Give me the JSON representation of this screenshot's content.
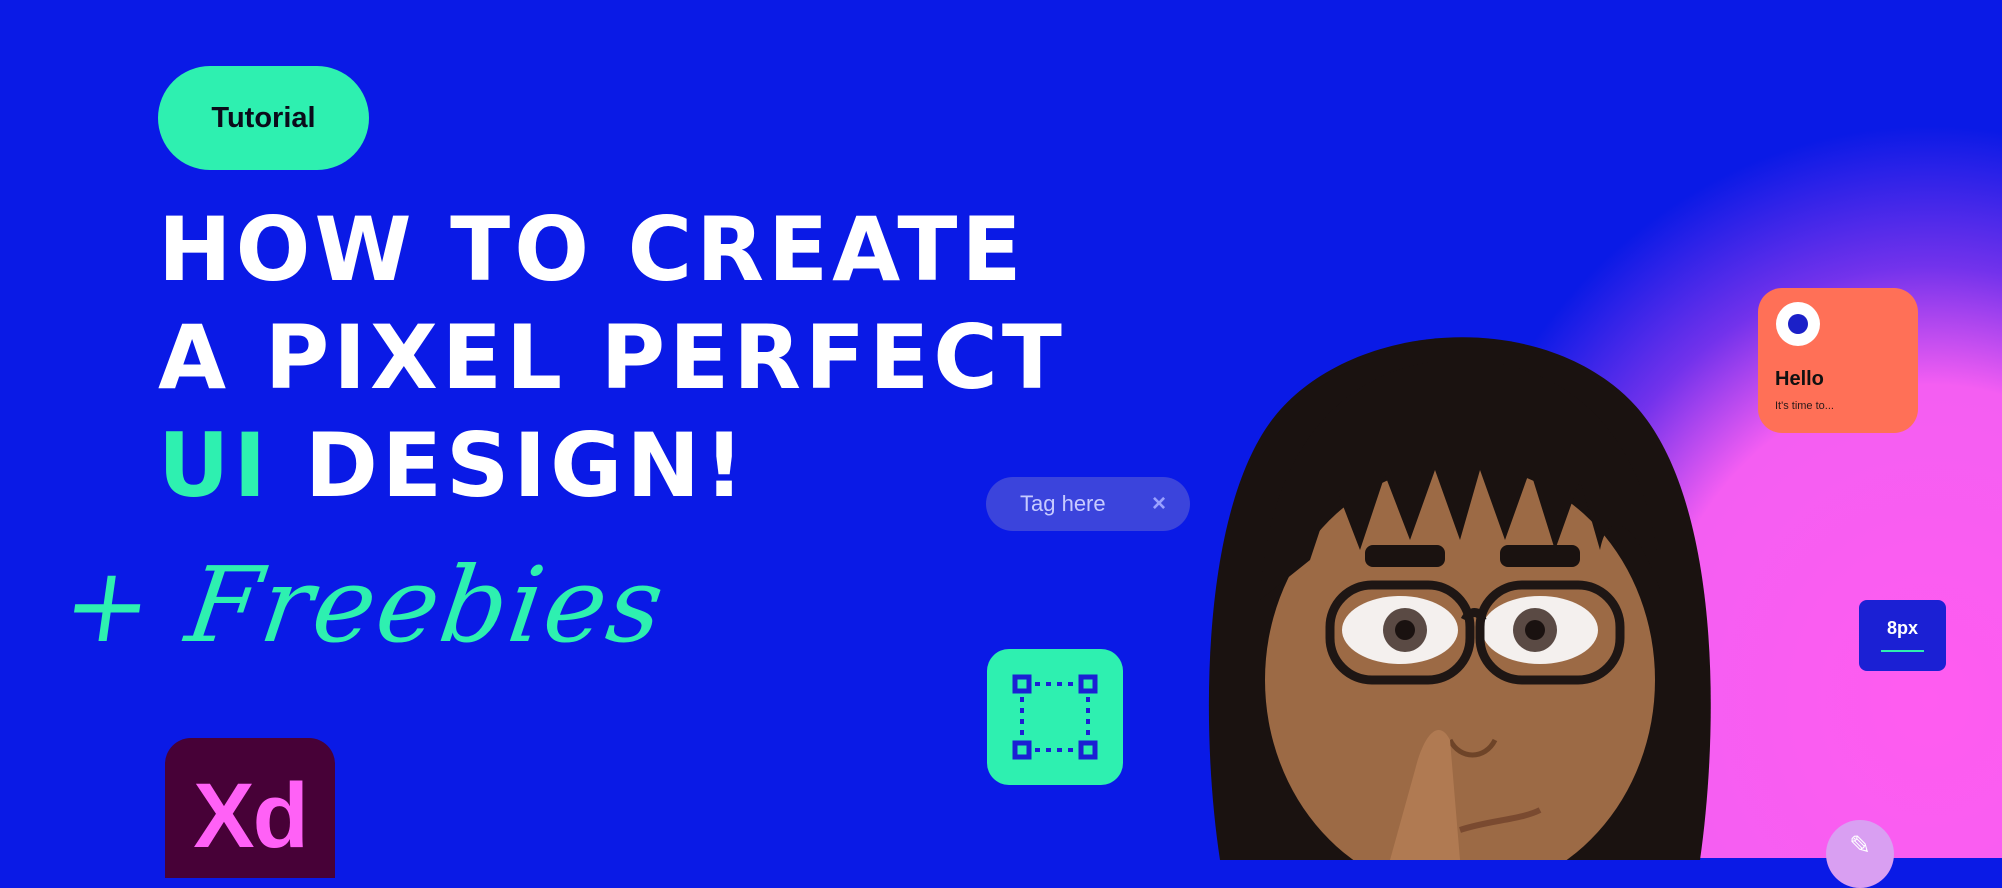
{
  "badge": {
    "label": "Tutorial"
  },
  "headline": {
    "line1": "HOW TO CREATE",
    "line2": "A PIXEL PERFECT",
    "line3_accent": "UI",
    "line3_rest": " DESIGN!"
  },
  "freebies": {
    "text": "+ Freebies"
  },
  "xd_logo": {
    "text": "Xd"
  },
  "tag_chip": {
    "label": "Tag here",
    "close": "×"
  },
  "card": {
    "title": "Hello",
    "subtitle": "It's time to..."
  },
  "spacing_badge": {
    "label": "8px"
  },
  "colors": {
    "background": "#0a1ae6",
    "accent_green": "#2ef0b0",
    "pink_glow": "#ff5cf0",
    "card_orange": "#ff7057",
    "xd_purple": "#470137",
    "xd_pink": "#ff61f6"
  },
  "icons": {
    "frame_tool": "frame-select-icon",
    "pencil": "pencil-icon",
    "close": "close-icon"
  }
}
